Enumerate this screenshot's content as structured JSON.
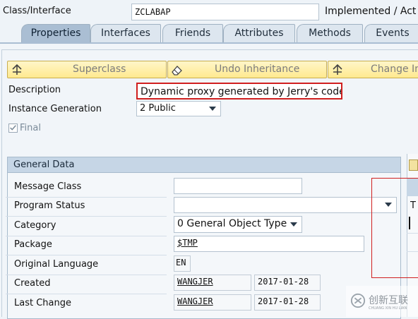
{
  "header": {
    "class_label": "Class/Interface",
    "class_value": "ZCLABAP",
    "status_text": "Implemented / Act"
  },
  "tabs": [
    "Properties",
    "Interfaces",
    "Friends",
    "Attributes",
    "Methods",
    "Events"
  ],
  "toolbar": {
    "superclass_label": "Superclass",
    "undo_inheritance_label": "Undo Inheritance",
    "change_inheritance_label": "Change In"
  },
  "props": {
    "description_label": "Description",
    "description_value": "Dynamic proxy generated by Jerry's code",
    "instance_label": "Instance Generation",
    "instance_value": "2 Public",
    "final_label": "Final",
    "final_checked": true
  },
  "general": {
    "title": "General Data",
    "message_class_label": "Message Class",
    "message_class_value": "",
    "program_status_label": "Program Status",
    "program_status_value": "",
    "category_label": "Category",
    "category_value": "0 General Object Type",
    "package_label": "Package",
    "package_value": "$TMP",
    "language_label": "Original Language",
    "language_value": "EN",
    "created_label": "Created",
    "created_user": "WANGJER",
    "created_date": "2017-01-28",
    "changed_label": "Last Change",
    "changed_user": "WANGJER",
    "changed_date": "2017-01-28"
  },
  "side": {
    "cut_text": "T"
  },
  "watermark": {
    "text": "创新互联",
    "sub": "CHUANG XIN HU LIAN"
  },
  "colors": {
    "highlight_box": "#d01f1f",
    "toolbar_button": "#ffe98f",
    "active_tab": "#aabed3"
  }
}
